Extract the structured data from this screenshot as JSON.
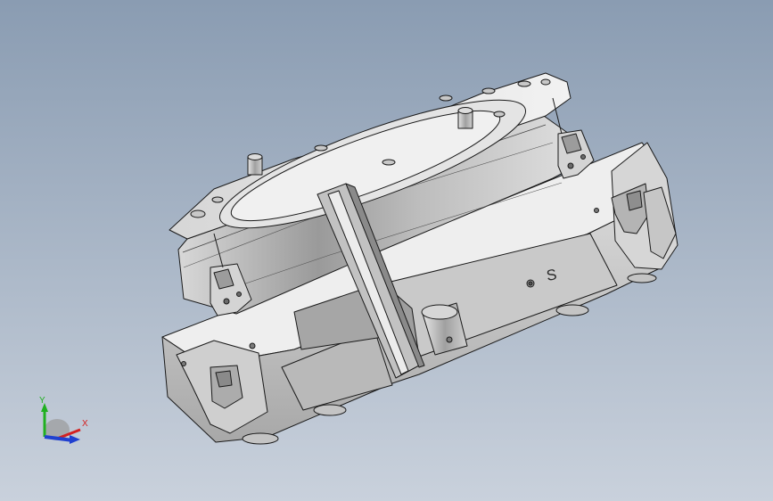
{
  "viewport": {
    "background_top": "#8a9cb2",
    "background_bottom": "#c9d1dc"
  },
  "model": {
    "part_engraving": "S"
  },
  "triad": {
    "x_label": "X",
    "y_label": "Y",
    "x_color": "#d42020",
    "y_color": "#20b020",
    "z_color": "#2040d0"
  }
}
